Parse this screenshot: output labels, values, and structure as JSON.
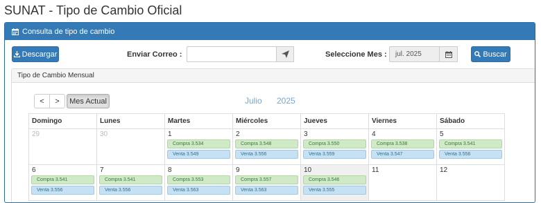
{
  "page": {
    "title": "SUNAT - Tipo de Cambio Oficial"
  },
  "panel": {
    "heading": "Consulta de tipo de cambio"
  },
  "toolbar": {
    "download_label": "Descargar",
    "email_label": "Enviar Correo :",
    "email_value": "",
    "month_label": "Seleccione Mes :",
    "month_value": "jul. 2025",
    "search_label": "Buscar"
  },
  "calendar": {
    "panel_title": "Tipo de Cambio Mensual",
    "prev_label": "<",
    "next_label": ">",
    "current_month_label": "Mes Actual",
    "month_name": "Julio",
    "year": "2025",
    "weekdays": [
      "Domingo",
      "Lunes",
      "Martes",
      "Miércoles",
      "Jueves",
      "Viernes",
      "Sábado"
    ],
    "weeks": [
      [
        {
          "day": "29",
          "other": true
        },
        {
          "day": "30",
          "other": true
        },
        {
          "day": "1",
          "compra": "Compra 3.534",
          "venta": "Venta 3.549"
        },
        {
          "day": "2",
          "compra": "Compra 3.548",
          "venta": "Venta 3.556"
        },
        {
          "day": "3",
          "compra": "Compra 3.550",
          "venta": "Venta 3.559"
        },
        {
          "day": "4",
          "compra": "Compra 3.538",
          "venta": "Venta 3.547"
        },
        {
          "day": "5",
          "compra": "Compra 3.541",
          "venta": "Venta 3.556"
        }
      ],
      [
        {
          "day": "6",
          "compra": "Compra 3.541",
          "venta": "Venta 3.556"
        },
        {
          "day": "7",
          "compra": "Compra 3.541",
          "venta": "Venta 3.556"
        },
        {
          "day": "8",
          "compra": "Compra 3.553",
          "venta": "Venta 3.563"
        },
        {
          "day": "9",
          "compra": "Compra 3.557",
          "venta": "Venta 3.563"
        },
        {
          "day": "10",
          "today": true,
          "compra": "Compra 3.546",
          "venta": "Venta 3.555"
        },
        {
          "day": "11"
        },
        {
          "day": "12"
        }
      ]
    ]
  }
}
